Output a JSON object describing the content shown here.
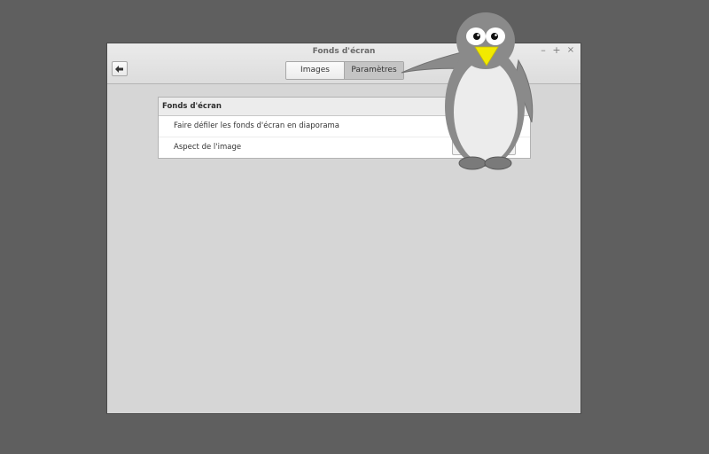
{
  "window": {
    "title": "Fonds d'écran",
    "minimize_label": "–",
    "maximize_label": "+",
    "close_label": "×"
  },
  "tabs": [
    {
      "label": "Images",
      "selected": false
    },
    {
      "label": "Paramètres",
      "selected": true
    }
  ],
  "settings": {
    "section_title": "Fonds d'écran",
    "rows": [
      {
        "label": "Faire défiler les fonds d'écran en diaporama"
      },
      {
        "label": "Aspect de l'image"
      }
    ]
  },
  "icons": {
    "back": "left-arrow-icon"
  },
  "colors": {
    "desktop": "#5f5f5f",
    "window_bg": "#d6d6d6",
    "selected_tab": "#c4c4c4",
    "penguin_body": "#8a8a8a",
    "penguin_beak": "#f2ea00"
  }
}
